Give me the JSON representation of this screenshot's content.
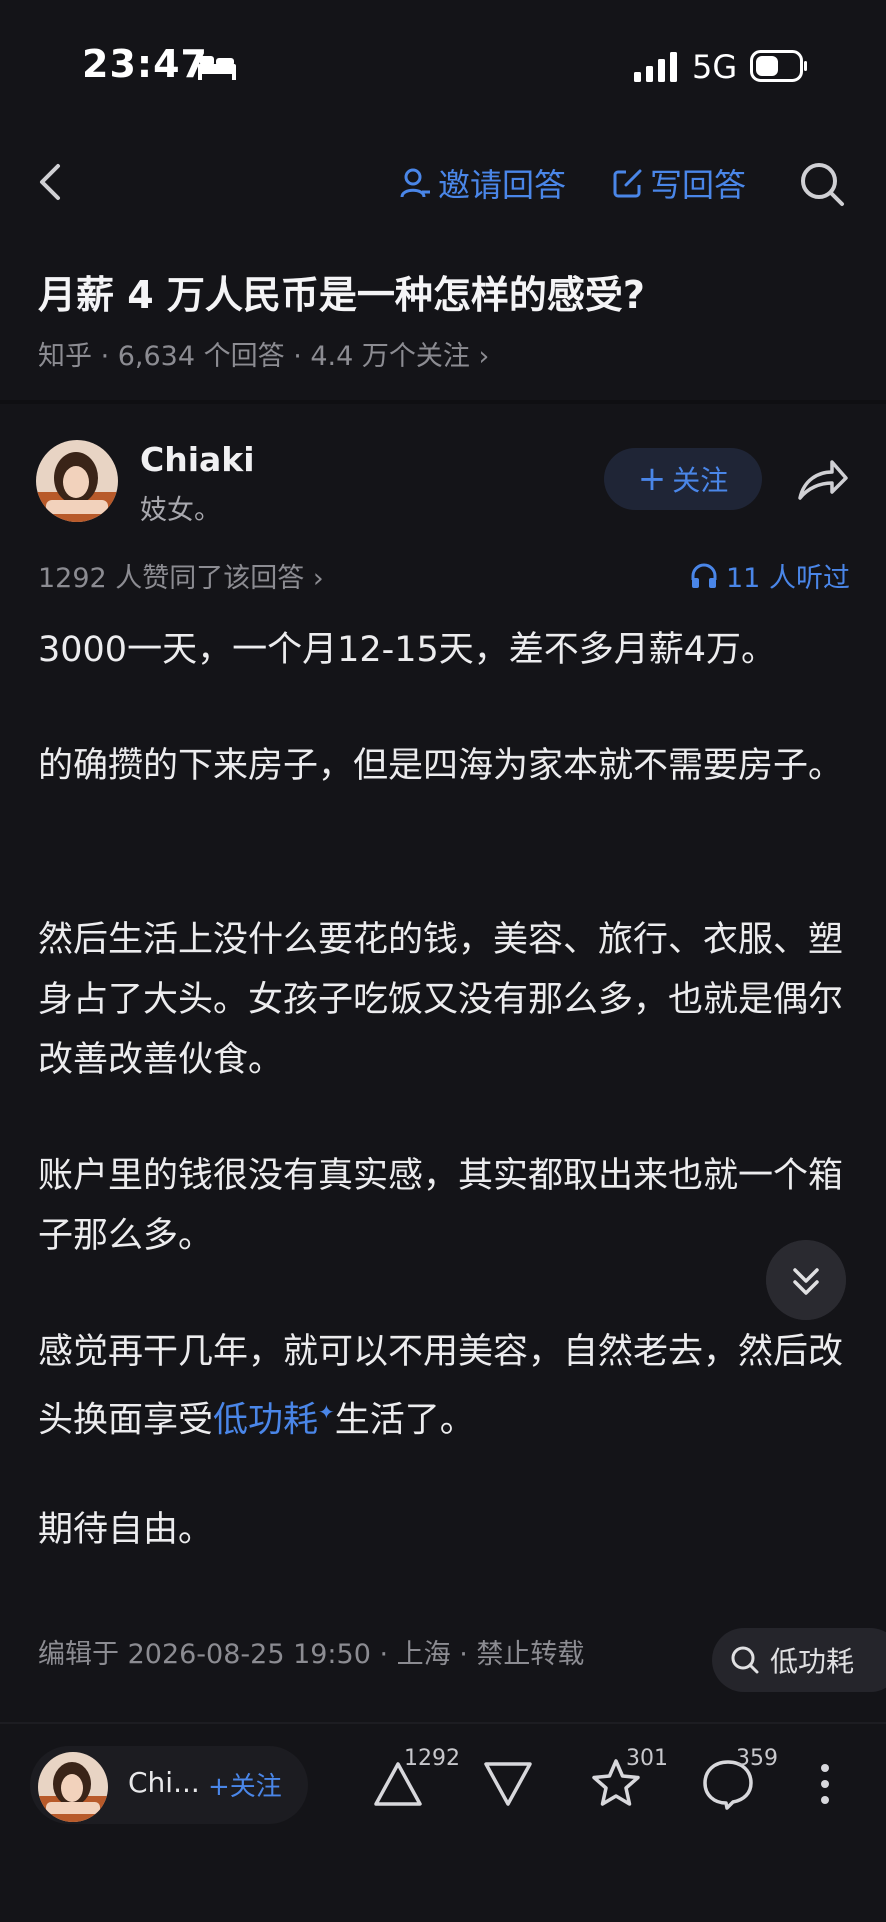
{
  "status": {
    "time": "23:47",
    "network": "5G"
  },
  "nav": {
    "invite_label": "邀请回答",
    "write_label": "写回答"
  },
  "question": {
    "title": "月薪 4 万人民币是一种怎样的感受?",
    "meta": "知乎 · 6,634 个回答 · 4.4 万个关注 ›"
  },
  "author": {
    "name": "Chiaki",
    "bio": "妓女。",
    "follow_label": "关注"
  },
  "answer": {
    "votes": "1292 人赞同了该回答 ›",
    "listen": "11 人听过",
    "paragraphs": [
      "3000一天，一个月12-15天，差不多月薪4万。",
      "的确攒的下来房子，但是四海为家本就不需要房子。",
      "然后生活上没什么要花的钱，美容、旅行、衣服、塑身占了大头。女孩子吃饭又没有那么多，也就是偶尔改善改善伙食。",
      "账户里的钱很没有真实感，其实都取出来也就一个箱子那么多。",
      "感觉再干几年，就可以不用美容，自然老去，然后改头换面享受",
      "生活了。",
      "期待自由。"
    ],
    "link_text": "低功耗",
    "edit_meta": "编辑于 2026-08-25 19:50 · 上海 · 禁止转载",
    "search_chip": "低功耗"
  },
  "bottom": {
    "name": "Chi...",
    "follow_label": "+关注",
    "upvotes": "1292",
    "favorites": "301",
    "comments": "359"
  },
  "colors": {
    "accent": "#4a86e8",
    "background": "#141418"
  }
}
